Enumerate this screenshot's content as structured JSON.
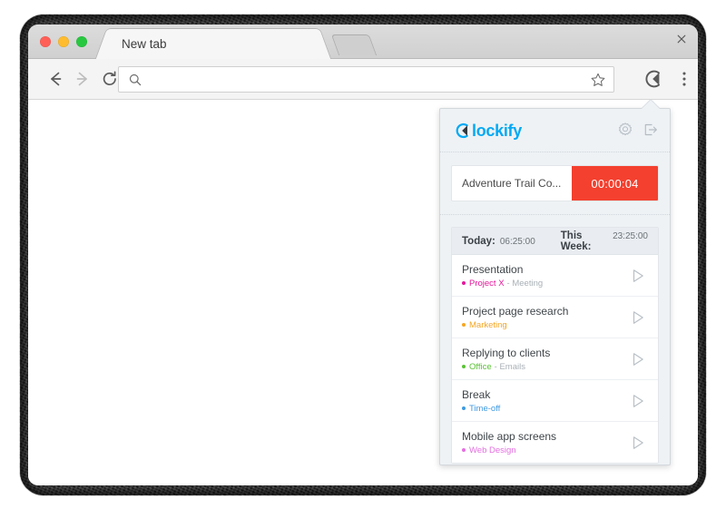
{
  "browser": {
    "traffic_lights": [
      "close",
      "minimize",
      "maximize"
    ],
    "tab": {
      "title": "New tab",
      "close_icon": "close-icon"
    },
    "new_tab_button_icon": "new-tab-icon",
    "nav": {
      "back_icon": "arrow-back-icon",
      "forward_icon": "arrow-forward-icon",
      "reload_icon": "reload-icon"
    },
    "omnibox": {
      "value": "",
      "placeholder": "",
      "search_icon": "search-icon",
      "bookmark_icon": "star-icon"
    },
    "extension_icon": "clockify-clock-icon",
    "menu_icon": "three-dot-menu-icon"
  },
  "popup": {
    "brand": {
      "mark_icon": "clockify-clock-icon",
      "name": "lockify",
      "accent_color": "#03a9f4"
    },
    "header_actions": [
      {
        "name": "settings",
        "icon": "gear-icon"
      },
      {
        "name": "logout",
        "icon": "logout-icon"
      }
    ],
    "timer": {
      "description": "Adventure Trail Co...",
      "elapsed": "00:00:04",
      "button_color": "#f4402f",
      "running": true
    },
    "stats": {
      "today_label": "Today:",
      "today_value": "06:25:00",
      "week_label": "This Week:",
      "week_value": "23:25:00"
    },
    "entries": [
      {
        "title": "Presentation",
        "project": "Project X",
        "task": "- Meeting",
        "color": "#e3189a",
        "play_icon": "play-icon"
      },
      {
        "title": "Project page research",
        "project": "Marketing",
        "task": "",
        "color": "#f5a623",
        "play_icon": "play-icon"
      },
      {
        "title": "Replying to clients",
        "project": "Office",
        "task": "- Emails",
        "color": "#5bc236",
        "play_icon": "play-icon"
      },
      {
        "title": "Break",
        "project": "Time-off",
        "task": "",
        "color": "#3f9ae0",
        "play_icon": "play-icon"
      },
      {
        "title": "Mobile app screens",
        "project": "Web Design",
        "task": "",
        "color": "#e46fe0",
        "play_icon": "play-icon"
      }
    ]
  }
}
